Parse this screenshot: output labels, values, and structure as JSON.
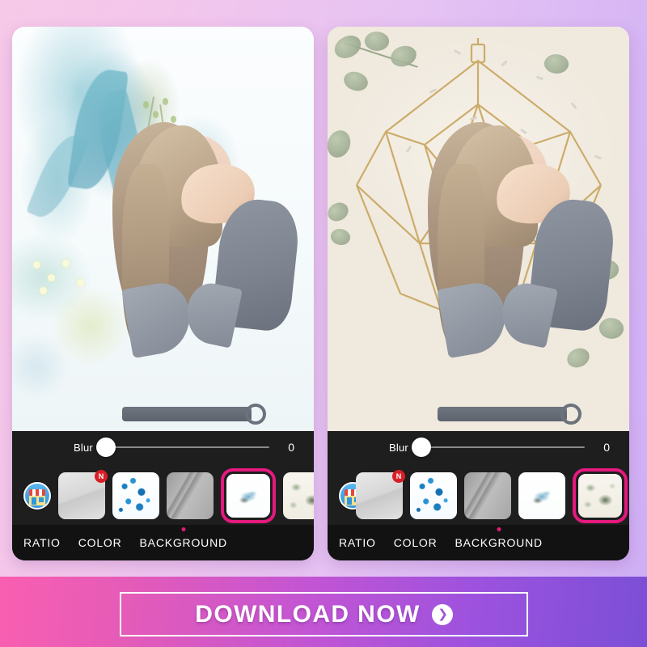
{
  "theme": {
    "bg_gradient_start": "#f7c9e8",
    "bg_gradient_end": "#cfaff5",
    "accent_pink": "#e5197e",
    "tray_dark": "#1e1e1e",
    "tabbar_dark": "#121212",
    "badge_red": "#d91f26",
    "cta_gradient_start": "#f95fb0",
    "cta_gradient_end": "#7b4fd6"
  },
  "panels": [
    {
      "id": "left",
      "name": "before-panel",
      "photo": {
        "subject_alt": "woman in grey blouse covering eyes with hand",
        "background_alt": "blue watercolour leaves and white blossoms"
      },
      "tray": {
        "slider": {
          "label": "Blur",
          "value": "0",
          "knob_position_pct": 0
        },
        "store_icon_name": "store-icon",
        "thumbnails": [
          {
            "name": "thumb-fabric",
            "art": "t-fabric",
            "badge": "N",
            "selected": false
          },
          {
            "name": "thumb-blossom",
            "art": "t-blossom",
            "badge": "",
            "selected": false
          },
          {
            "name": "thumb-wall",
            "art": "t-wall",
            "badge": "",
            "selected": false
          },
          {
            "name": "thumb-blue-sprig",
            "art": "t-sprigblue",
            "badge": "",
            "selected": true
          },
          {
            "name": "thumb-eucalyptus",
            "art": "t-euc",
            "badge": "",
            "selected": false
          }
        ]
      },
      "tabs": [
        {
          "label": "RATIO",
          "active": false
        },
        {
          "label": "COLOR",
          "active": false
        },
        {
          "label": "BACKGROUND",
          "active": true
        }
      ]
    },
    {
      "id": "right",
      "name": "after-panel",
      "photo": {
        "subject_alt": "woman in grey blouse covering eyes with hand",
        "background_alt": "cream wall with gold geometric frame and eucalyptus"
      },
      "tray": {
        "slider": {
          "label": "Blur",
          "value": "0",
          "knob_position_pct": 0
        },
        "store_icon_name": "store-icon",
        "thumbnails": [
          {
            "name": "thumb-fabric",
            "art": "t-fabric",
            "badge": "N",
            "selected": false
          },
          {
            "name": "thumb-blossom",
            "art": "t-blossom",
            "badge": "",
            "selected": false
          },
          {
            "name": "thumb-wall",
            "art": "t-wall",
            "badge": "",
            "selected": false
          },
          {
            "name": "thumb-blue-sprig",
            "art": "t-sprigblue",
            "badge": "",
            "selected": false
          },
          {
            "name": "thumb-eucalyptus",
            "art": "t-euc",
            "badge": "",
            "selected": true
          },
          {
            "name": "thumb-gold",
            "art": "t-gold",
            "badge": "",
            "selected": false
          }
        ]
      },
      "tabs": [
        {
          "label": "RATIO",
          "active": false
        },
        {
          "label": "COLOR",
          "active": false
        },
        {
          "label": "BACKGROUND",
          "active": true
        }
      ]
    }
  ],
  "cta": {
    "label": "DOWNLOAD NOW",
    "arrow_glyph": "❯",
    "arrow_icon_name": "chevron-right-icon"
  }
}
